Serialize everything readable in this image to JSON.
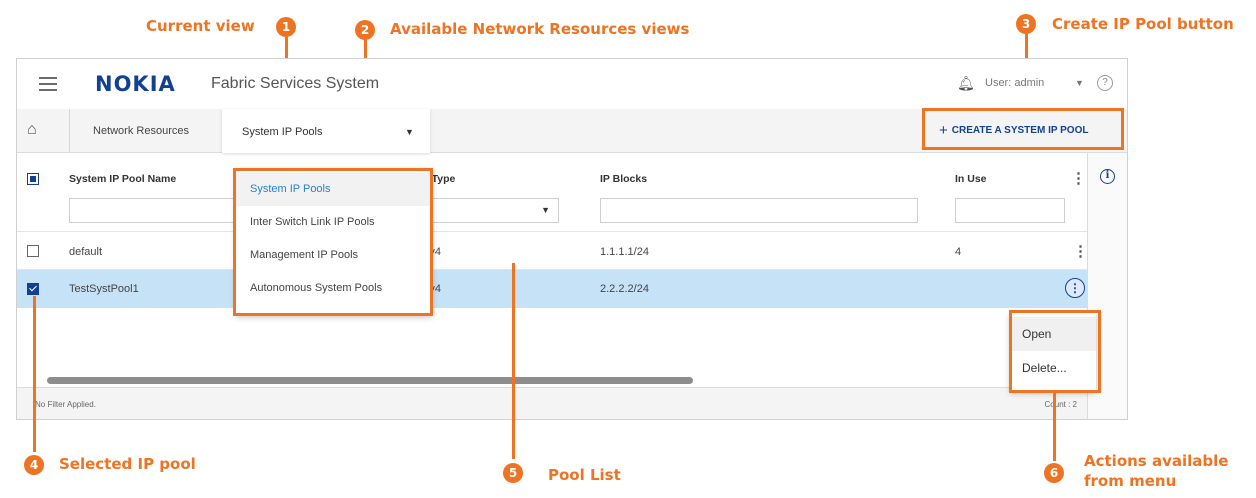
{
  "callouts": {
    "current_view": "Current view",
    "available_views": "Available Network Resources views",
    "create_button": "Create IP Pool button",
    "selected_pool": "Selected IP pool",
    "pool_list": "Pool List",
    "actions_line1": "Actions available",
    "actions_line2": "from menu",
    "numbers": [
      "1",
      "2",
      "3",
      "4",
      "5",
      "6"
    ]
  },
  "header": {
    "logo": "NOKIA",
    "title": "Fabric Services System",
    "user_label": "User: admin",
    "help": "?"
  },
  "toolbar": {
    "breadcrumb": "Network Resources",
    "current_view": "System IP Pools",
    "create_button": "CREATE A SYSTEM IP POOL"
  },
  "view_options": [
    "System IP Pools",
    "Inter Switch Link IP Pools",
    "Management IP Pools",
    "Autonomous System Pools"
  ],
  "table": {
    "columns": [
      "System IP Pool Name",
      "IP Type",
      "IP Blocks",
      "In Use"
    ],
    "rows": [
      {
        "name": "default",
        "ip_type": "IPv4",
        "ip_blocks": "1.1.1.1/24",
        "in_use": "4",
        "selected": false
      },
      {
        "name": "TestSystPool1",
        "ip_type": "IPv4",
        "ip_blocks": "2.2.2.2/24",
        "in_use": "",
        "selected": true
      }
    ]
  },
  "row_actions": [
    "Open",
    "Delete..."
  ],
  "footer": {
    "filter_status": "No Filter Applied.",
    "count": "Count : 2"
  },
  "colors": {
    "accent": "#ee7322",
    "brand": "#124191",
    "selected_row": "#c6e2f6"
  },
  "icons": [
    "menu-icon",
    "bell-icon",
    "help-icon",
    "home-icon",
    "plus-icon",
    "info-icon",
    "kebab-icon",
    "chevron-down-icon"
  ]
}
